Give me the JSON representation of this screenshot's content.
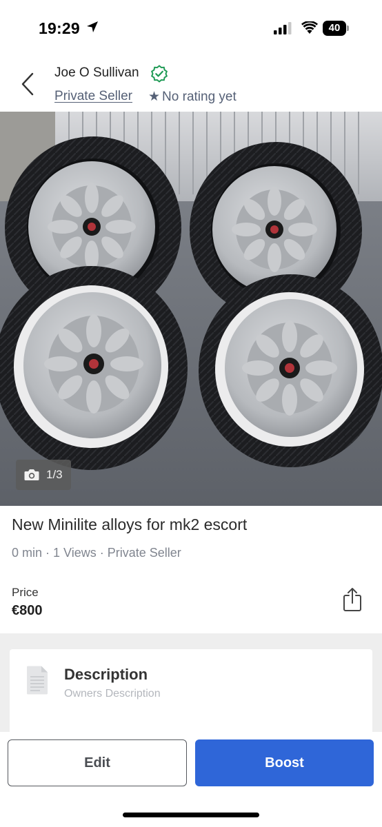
{
  "status_bar": {
    "time": "19:29",
    "battery": "40"
  },
  "header": {
    "seller_name": "Joe O Sullivan",
    "seller_type": "Private Seller",
    "rating_text": "No rating yet"
  },
  "gallery": {
    "counter": "1/3",
    "photo_count": 3,
    "current_index": 1
  },
  "listing": {
    "title": "New Minilite alloys for mk2 escort",
    "meta": "0 min · 1 Views · Private Seller",
    "price_label": "Price",
    "price": "€800"
  },
  "description": {
    "title": "Description",
    "subtitle": "Owners Description"
  },
  "actions": {
    "edit_label": "Edit",
    "boost_label": "Boost"
  },
  "colors": {
    "accent": "#2f66d8",
    "verified": "#1f9a55",
    "muted": "#556076"
  },
  "icons": [
    "location-arrow-icon",
    "signal-icon",
    "wifi-icon",
    "battery-icon",
    "back-chevron-icon",
    "verified-badge-icon",
    "star-icon",
    "camera-icon",
    "share-icon",
    "document-icon"
  ]
}
